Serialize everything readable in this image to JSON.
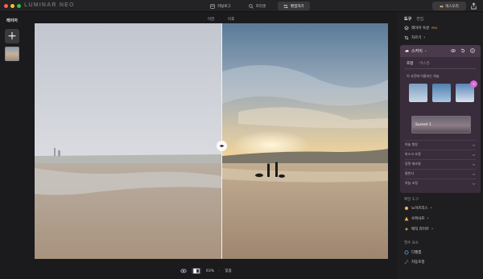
{
  "app": {
    "brand": "LUMINAR NEO",
    "traffic_colors": [
      "#fe5f57",
      "#febc2e",
      "#28c840"
    ]
  },
  "titlebar": {
    "tabs": [
      {
        "label": "카탈로그",
        "icon": "catalog-icon",
        "active": false
      },
      {
        "label": "프리셋",
        "icon": "presets-icon",
        "active": false
      },
      {
        "label": "편집하기",
        "icon": "edit-icon",
        "active": true
      }
    ],
    "account_label": "렉스모리"
  },
  "left": {
    "layers_label": "레이어",
    "add_label": "+"
  },
  "canvas": {
    "before_label": "이전",
    "after_label": "이후",
    "zoom": "63%",
    "fit_label": "맞춤"
  },
  "panel": {
    "tab_tools": "도구",
    "tab_edits": "편집",
    "items": [
      {
        "label": "레이어 속성",
        "icon": "layers-properties-icon",
        "pro": "PRO"
      },
      {
        "label": "자르기",
        "icon": "crop-icon",
        "pro": "*"
      }
    ],
    "sky": {
      "title": "스카이",
      "tab_presets": "조정",
      "tab_masking": "마스킹",
      "hint": "이 사진에 어울리는 하늘",
      "preset_name": "Sunset 1",
      "badge": "+",
      "sections": [
        "하늘 향상",
        "마스크 조정",
        "장면 재조명",
        "물반사",
        "하늘 조정"
      ]
    },
    "extension_label": "확장 도구",
    "extensions": [
      {
        "label": "노이즈리스",
        "icon": "noiseless-icon",
        "pro": "*"
      },
      {
        "label": "수퍼샤프",
        "icon": "supersharp-icon",
        "pro": "*"
      },
      {
        "label": "매직 라이트",
        "icon": "magic-light-icon",
        "pro": "*"
      }
    ],
    "essentials_label": "필수 요소",
    "essentials": [
      {
        "label": "디벨롭",
        "icon": "develop-icon"
      },
      {
        "label": "자동조정",
        "icon": "enhance-icon"
      }
    ]
  },
  "colors": {
    "accent_pro": "#e9b25a",
    "sky_card_bg": "#3a2d3b",
    "badge": "#d86ad0"
  }
}
